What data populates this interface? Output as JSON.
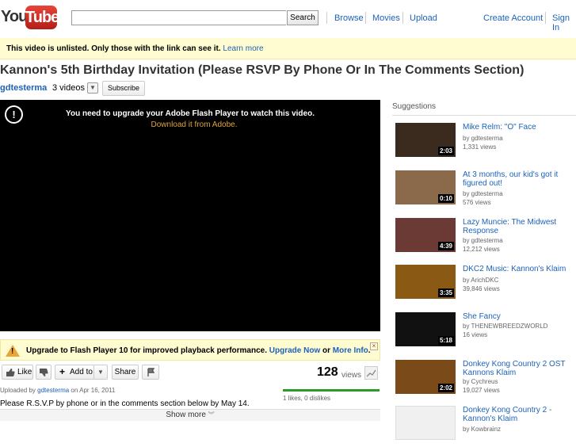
{
  "header": {
    "logo_you": "You",
    "logo_tube": "Tube",
    "search_placeholder": "",
    "search_button": "Search",
    "nav": [
      "Browse",
      "Movies",
      "Upload"
    ],
    "create_account": "Create Account",
    "sign_in": "Sign In"
  },
  "notice": {
    "text": "This video is unlisted. Only those with the link can see it.",
    "link": "Learn more"
  },
  "video": {
    "title": "Kannon's 5th Birthday Invitation (Please RSVP By Phone Or In The Comments Section)",
    "channel": "gdtesterma",
    "video_count": "3 videos",
    "subscribe": "Subscribe",
    "player_message": "You need to upgrade your Adobe Flash Player to watch this video.",
    "player_link": "Download it from Adobe.",
    "alert_glyph": "!"
  },
  "upgrade": {
    "text": "Upgrade to Flash Player 10 for improved playback performance.",
    "upgrade_now": "Upgrade Now",
    "or": "or",
    "more_info": "More Info",
    "dot": ".",
    "close": "×"
  },
  "actions": {
    "like": "Like",
    "add_to": "Add to",
    "share": "Share",
    "views": "128",
    "views_label": "views"
  },
  "meta": {
    "uploaded_prefix": "Uploaded by",
    "uploader": "gdtesterma",
    "date": "on Apr 16, 2011",
    "likes": "1 likes, 0 dislikes",
    "description": "Please R.S.V.P by phone or in the comments section below by May 14.",
    "show_more": "Show more"
  },
  "sidebar": {
    "title": "Suggestions",
    "items": [
      {
        "title": "Mike Relm: \"O\" Face",
        "by": "by gdtesterma",
        "views": "1,331 views",
        "duration": "2:03",
        "thumb_color": "#3b2a1e"
      },
      {
        "title": "At 3 months, our kid's got it figured out!",
        "by": "by gdtesterma",
        "views": "576 views",
        "duration": "0:10",
        "thumb_color": "#8a6a4a"
      },
      {
        "title": "Lazy Muncie: The Midwest Response",
        "by": "by gdtesterma",
        "views": "12,212 views",
        "duration": "4:39",
        "thumb_color": "#6b3a34"
      },
      {
        "title": "DKC2 Music: Kannon's Klaim",
        "by": "by ArichDKC",
        "views": "39,846 views",
        "duration": "3:35",
        "thumb_color": "#8a5a14"
      },
      {
        "title": "She Fancy",
        "by": "by THENEWBREEDZWORLD",
        "views": "16 views",
        "duration": "5:18",
        "thumb_color": "#111111"
      },
      {
        "title": "Donkey Kong Country 2 OST Kannons Klaim",
        "by": "by Cychreus",
        "views": "19,027 views",
        "duration": "2:02",
        "thumb_color": "#7a4a18"
      },
      {
        "title": "Donkey Kong Country 2 - Kannon's Klaim",
        "by": "by Kowbrainz",
        "views": "",
        "duration": "",
        "thumb_color": "#f0f0f0"
      }
    ]
  }
}
